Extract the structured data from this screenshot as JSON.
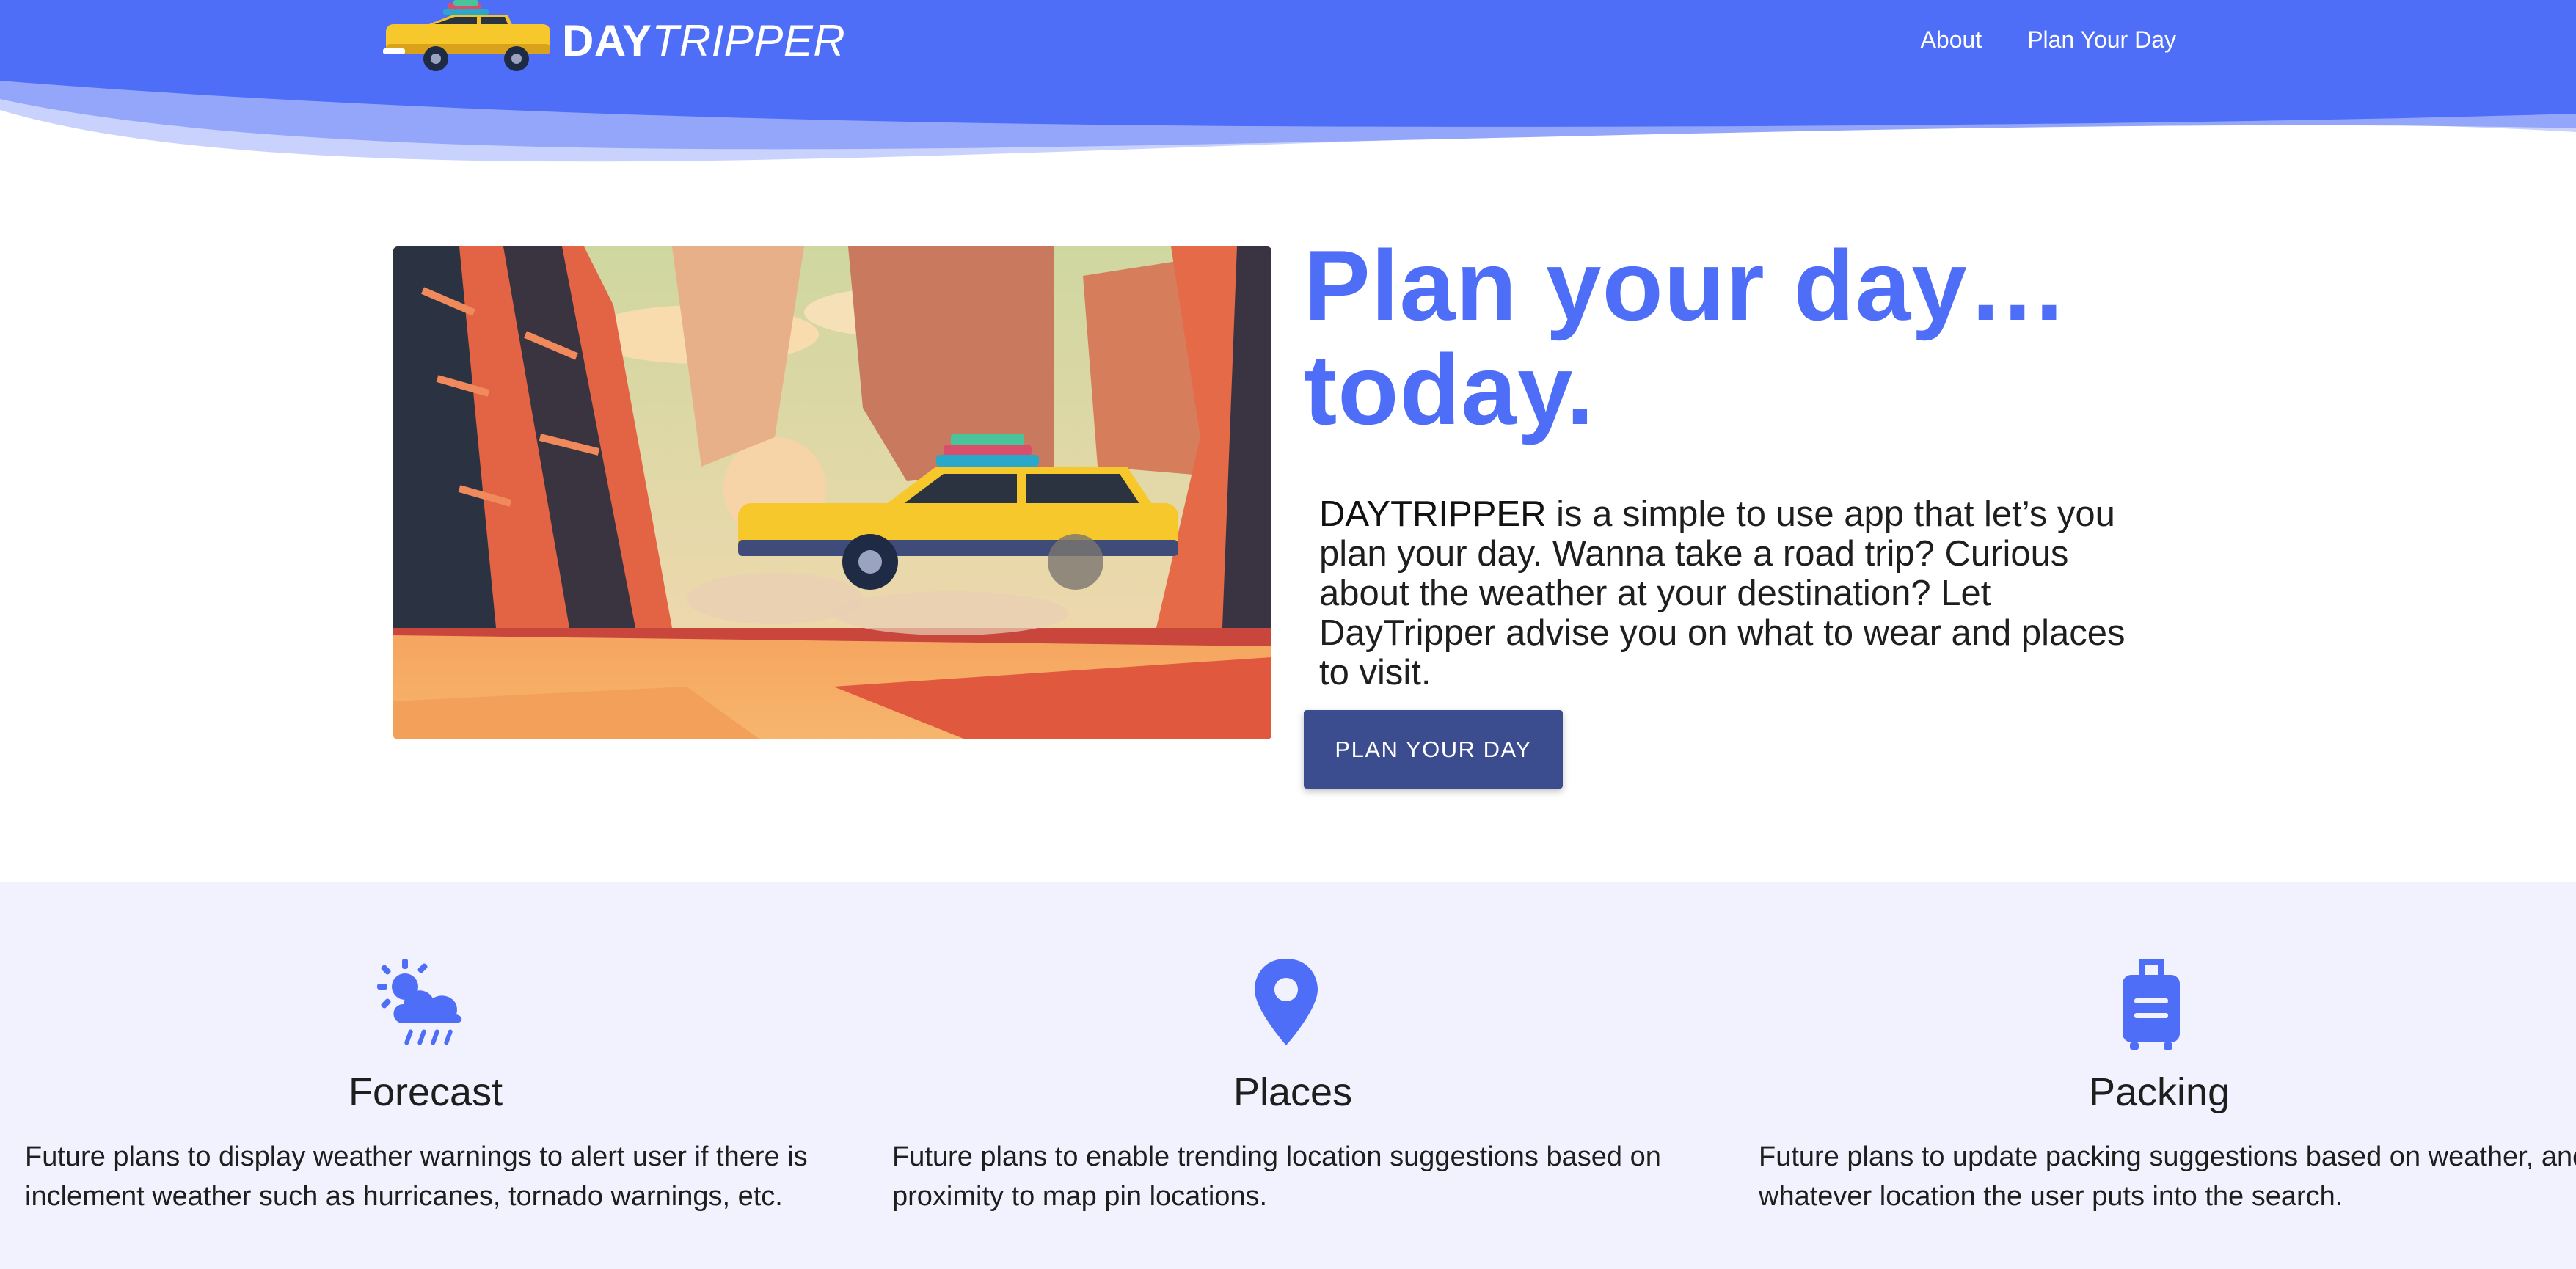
{
  "header": {
    "brand_bold": "DAY",
    "brand_light": "TRIPPER",
    "logo_icon": "car-with-luggage-icon",
    "nav": [
      {
        "label": "About"
      },
      {
        "label": "Plan Your Day"
      }
    ],
    "colors": {
      "primary": "#4f6ef7",
      "wave_light": "#a9b8fb",
      "wave_mid": "#8097f9"
    }
  },
  "hero": {
    "image_icon": "desert-canyon-road-trip-illustration",
    "title": "Plan your day… today.",
    "description_brand": "DAYTRIPPER",
    "description_rest": " is a simple to use app that let’s you plan your day. Wanna take a road trip? Curious about the weather at your destination? Let DayTripper advise you on what to wear and places to visit.",
    "cta_label": "PLAN YOUR DAY",
    "colors": {
      "title": "#4f6ef7",
      "cta": "#3c4d8f"
    }
  },
  "features": [
    {
      "icon": "cloud-sun-rain-icon",
      "title": "Forecast",
      "text": "Future plans to display weather warnings to alert user if there is inclement weather such as hurricanes, tornado warnings, etc."
    },
    {
      "icon": "map-pin-icon",
      "title": "Places",
      "text": "Future plans to enable trending location suggestions based on proximity to map pin locations."
    },
    {
      "icon": "suitcase-icon",
      "title": "Packing",
      "text": "Future plans to update packing suggestions based on weather, and whatever location the user puts into the search."
    }
  ],
  "colors": {
    "features_bg": "#f1f2fd",
    "icon": "#4f6ef7"
  }
}
